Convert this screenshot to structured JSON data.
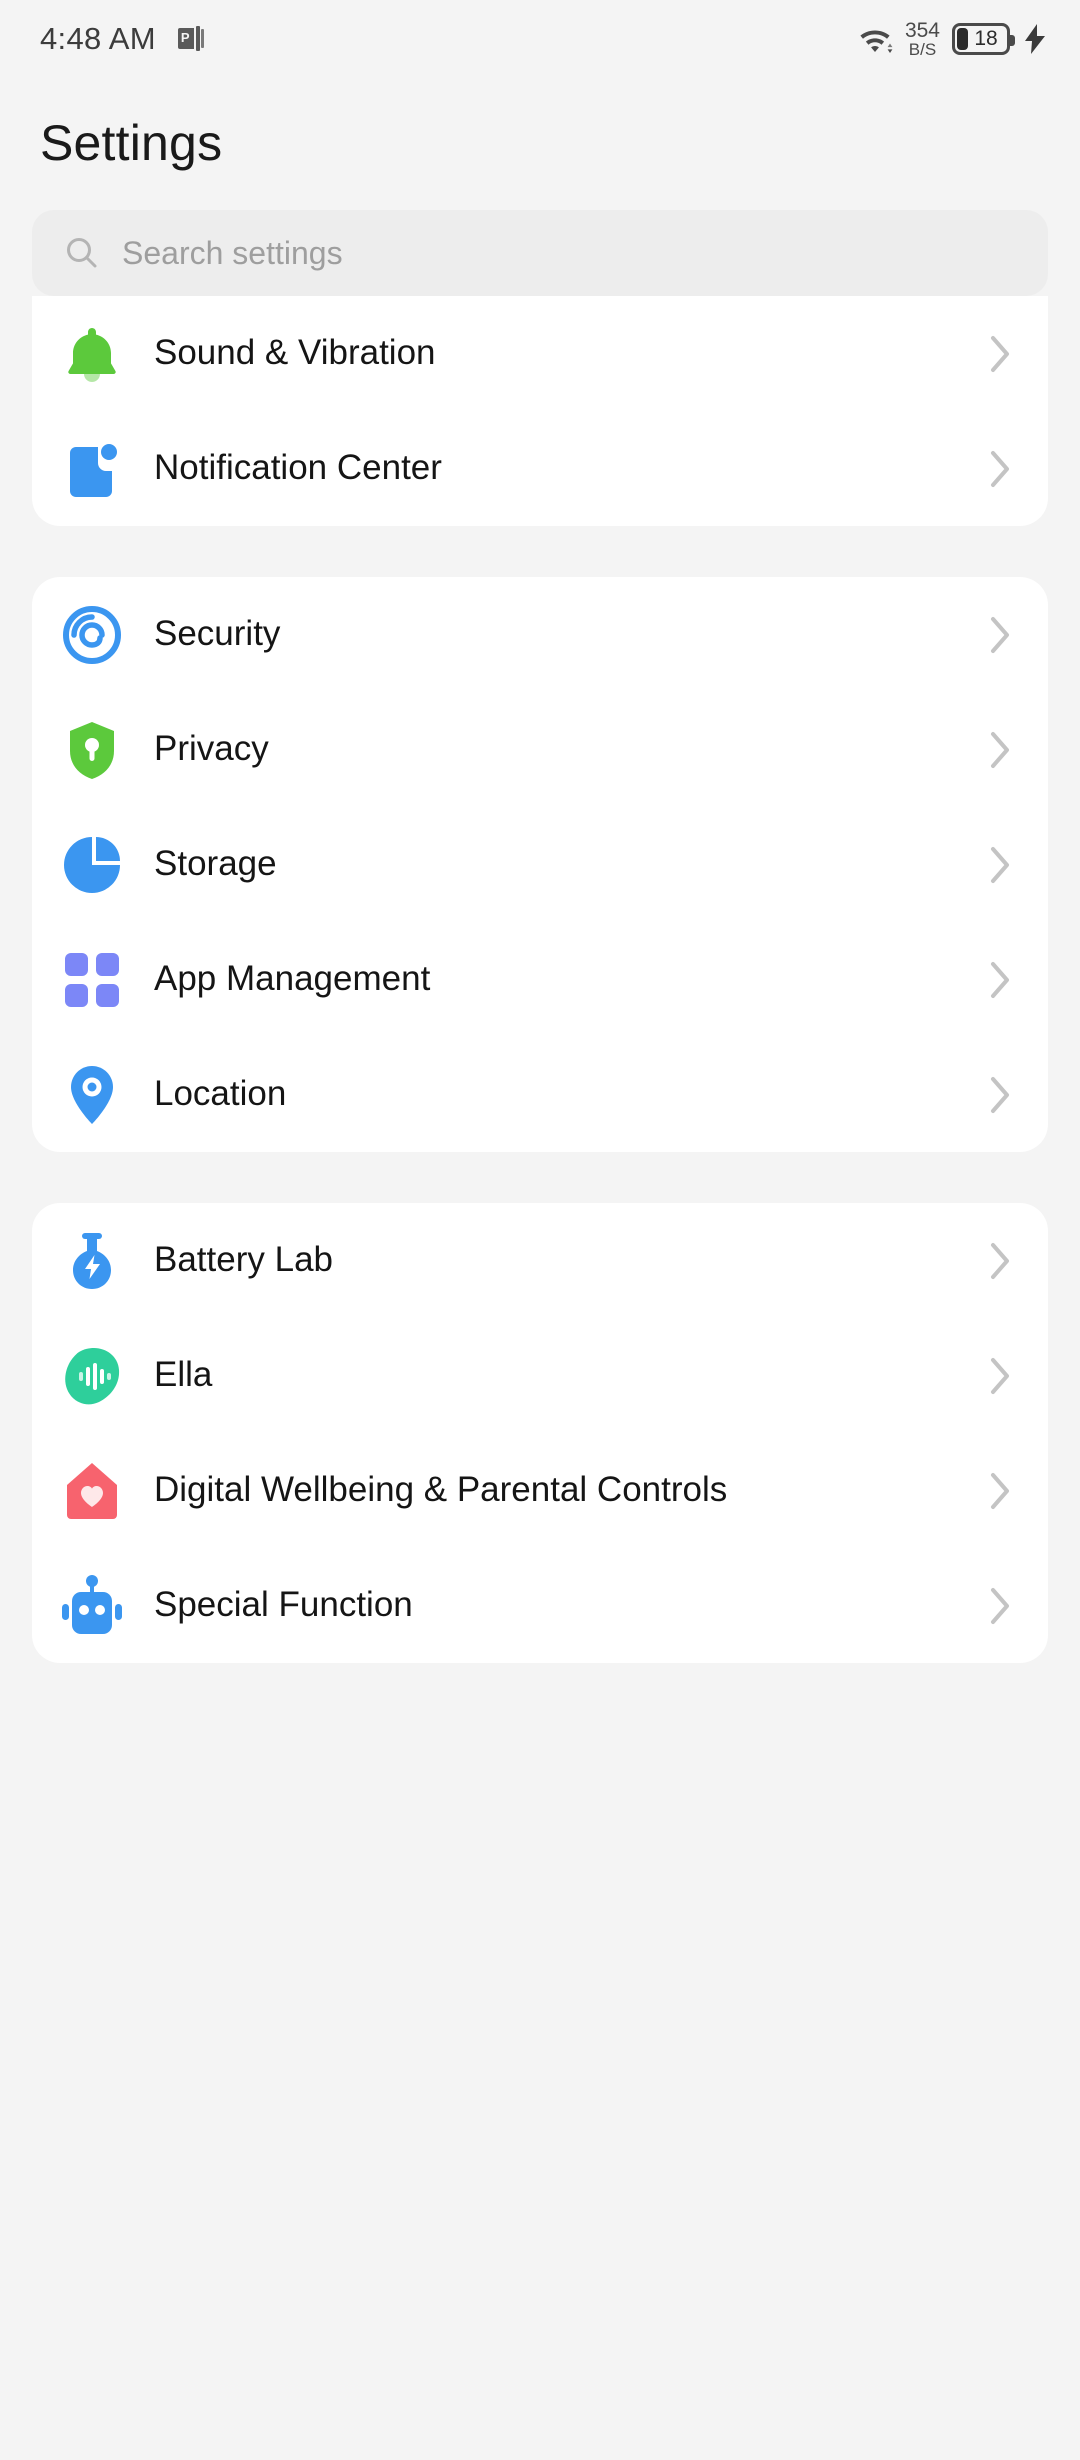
{
  "statusbar": {
    "time": "4:48 AM",
    "app_icon": "app-notification-icon",
    "app_icon_glyph": "P",
    "wifi_icon": "wifi-icon",
    "network_speed_value": "354",
    "network_speed_unit": "B/S",
    "battery_level": "18",
    "battery_icon": "battery-icon",
    "charging_icon": "charging-bolt-icon"
  },
  "header": {
    "title": "Settings"
  },
  "search": {
    "placeholder": "Search settings",
    "icon": "search-icon"
  },
  "colors": {
    "background": "#f4f4f4",
    "card": "#ffffff",
    "search_field": "#ededed",
    "green": "#5cc93c",
    "blue": "#3b96f0",
    "periwinkle": "#7c87f7",
    "teal": "#2ecf9b",
    "coral": "#f7636e",
    "chevron": "#c4c4c4",
    "title_text": "#1a1a1a",
    "label_text": "#151515",
    "placeholder_text": "#9e9e9e"
  },
  "cards": [
    {
      "partially_scrolled": true,
      "rows": [
        {
          "label": "Sound & Vibration",
          "icon": "bell-icon",
          "icon_color": "#5cc93c",
          "chevron": "chevron-right-icon"
        },
        {
          "label": "Notification Center",
          "icon": "notification-badge-icon",
          "icon_color": "#3b96f0",
          "chevron": "chevron-right-icon"
        }
      ]
    },
    {
      "partially_scrolled": false,
      "rows": [
        {
          "label": "Security",
          "icon": "fingerprint-circle-icon",
          "icon_color": "#3b96f0",
          "chevron": "chevron-right-icon"
        },
        {
          "label": "Privacy",
          "icon": "shield-key-icon",
          "icon_color": "#5cc93c",
          "chevron": "chevron-right-icon"
        },
        {
          "label": "Storage",
          "icon": "pie-chart-icon",
          "icon_color": "#3b96f0",
          "chevron": "chevron-right-icon"
        },
        {
          "label": "App Management",
          "icon": "grid-squares-icon",
          "icon_color": "#7c87f7",
          "chevron": "chevron-right-icon"
        },
        {
          "label": "Location",
          "icon": "map-pin-icon",
          "icon_color": "#3b96f0",
          "chevron": "chevron-right-icon"
        }
      ]
    },
    {
      "partially_scrolled": false,
      "rows": [
        {
          "label": "Battery Lab",
          "icon": "flask-bolt-icon",
          "icon_color": "#3b96f0",
          "chevron": "chevron-right-icon"
        },
        {
          "label": "Ella",
          "icon": "voice-wave-icon",
          "icon_color": "#2ecf9b",
          "chevron": "chevron-right-icon"
        },
        {
          "label": "Digital Wellbeing & Parental Controls",
          "icon": "house-heart-icon",
          "icon_color": "#f7636e",
          "chevron": "chevron-right-icon"
        },
        {
          "label": "Special Function",
          "icon": "robot-icon",
          "icon_color": "#3b96f0",
          "chevron": "chevron-right-icon"
        }
      ]
    }
  ]
}
